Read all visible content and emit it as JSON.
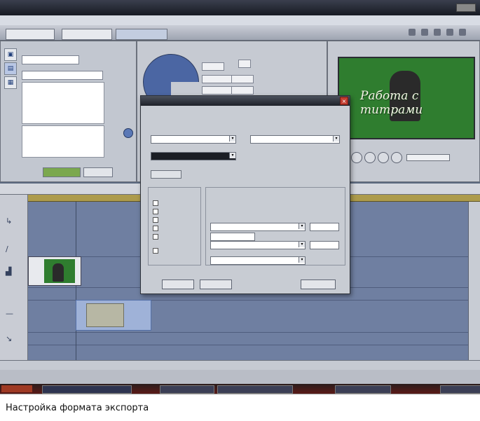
{
  "caption": "Настройка формата экспорта",
  "preview": {
    "overlay_text": [
      "Работа с",
      "титрами"
    ]
  },
  "colors": {
    "preview_bg": "#2f7d2f",
    "timeline_bg": "#6f7fa1",
    "ruler": "#ad9b4c",
    "dialog_close": "#c23b2f"
  },
  "icons": {
    "library_tools": [
      "film-icon",
      "title-icon",
      "grid-icon"
    ],
    "timeline_tools": [
      "arrow-icon",
      "pen-icon",
      "audio-icon",
      "scissors-icon",
      "trim-icon"
    ],
    "dialog": [
      "close-icon"
    ]
  }
}
